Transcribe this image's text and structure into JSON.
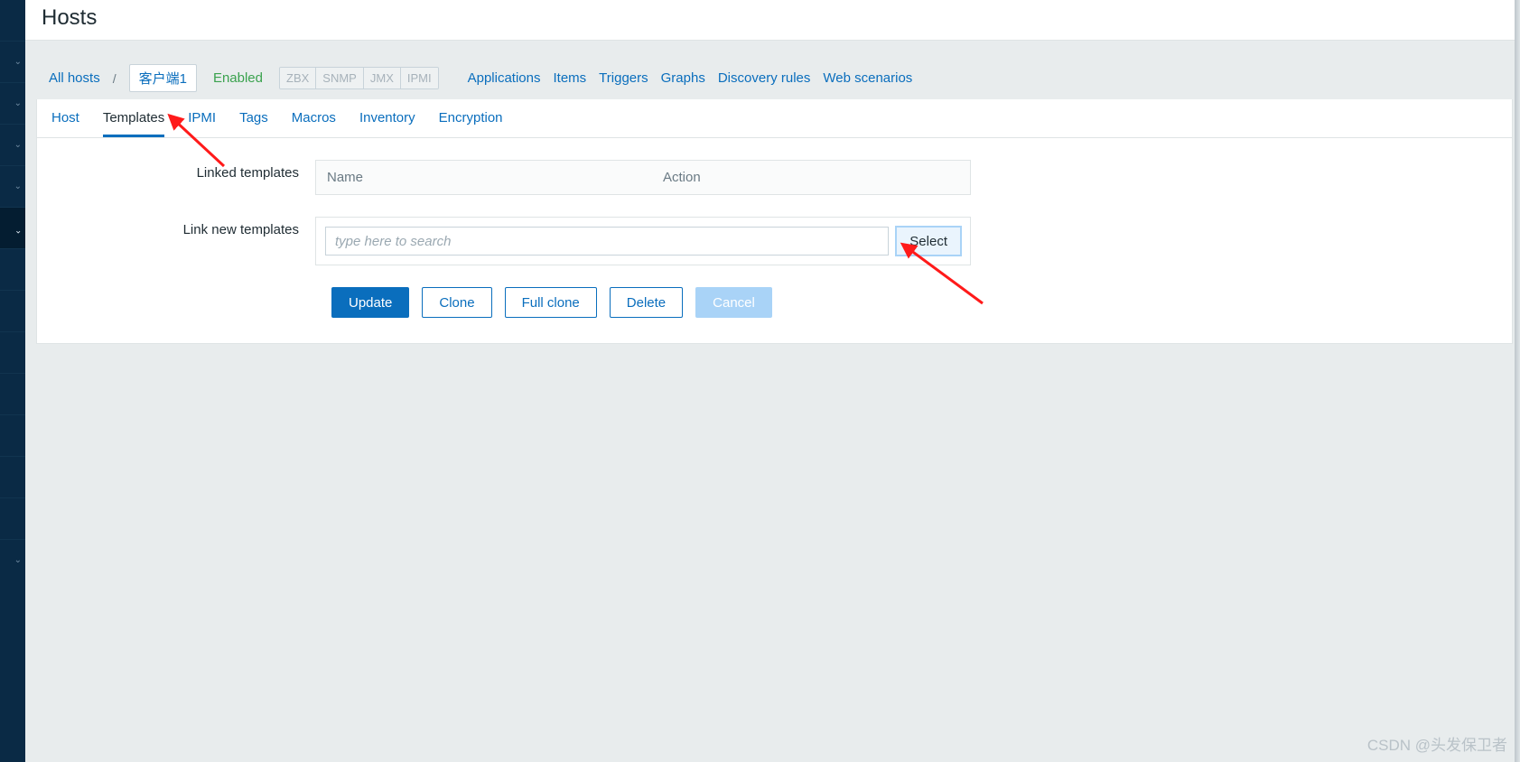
{
  "page": {
    "title": "Hosts"
  },
  "breadcrumb": {
    "all_hosts": "All hosts",
    "slash": "/",
    "host_name": "客户端1",
    "status": "Enabled",
    "protocols": [
      "ZBX",
      "SNMP",
      "JMX",
      "IPMI"
    ],
    "nav": [
      "Applications",
      "Items",
      "Triggers",
      "Graphs",
      "Discovery rules",
      "Web scenarios"
    ]
  },
  "tabs": {
    "items": [
      "Host",
      "Templates",
      "IPMI",
      "Tags",
      "Macros",
      "Inventory",
      "Encryption"
    ],
    "active": "Templates"
  },
  "form": {
    "linked_label": "Linked templates",
    "linked_cols": {
      "name": "Name",
      "action": "Action"
    },
    "link_new_label": "Link new templates",
    "search_placeholder": "type here to search",
    "select_btn": "Select"
  },
  "buttons": {
    "update": "Update",
    "clone": "Clone",
    "full_clone": "Full clone",
    "delete": "Delete",
    "cancel": "Cancel"
  },
  "watermark": "CSDN @头发保卫者"
}
